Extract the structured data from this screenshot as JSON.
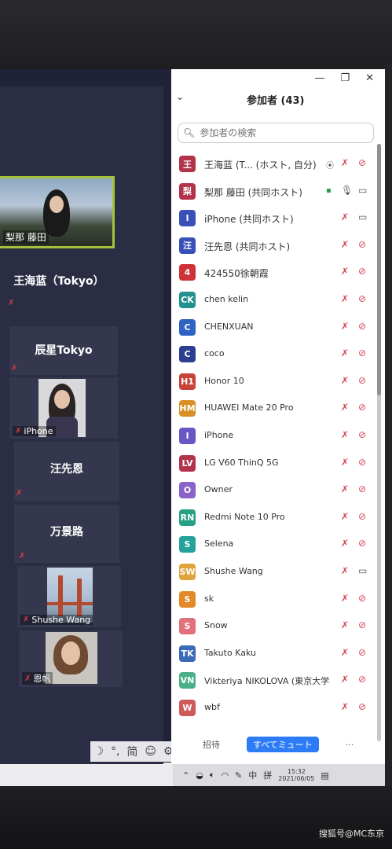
{
  "window": {
    "restore_icon": "restore-icon",
    "close_symbol": "✕"
  },
  "panel": {
    "title": "参加者 (43)",
    "collapse_symbol": "⌄",
    "search_placeholder": "参加者の検索",
    "participants": [
      {
        "initial": "王",
        "name": "王海蓝 (T... (ホスト, 自分)",
        "color": "#b2344b",
        "mic": "muted",
        "video": "off",
        "extra": "⦿"
      },
      {
        "initial": "梨",
        "name": "梨那 藤田 (共同ホスト)",
        "color": "#b2344b",
        "mic": "on",
        "video": "on",
        "extra": "▪"
      },
      {
        "initial": "I",
        "name": "iPhone (共同ホスト)",
        "color": "#3950b8",
        "mic": "muted",
        "video": "on",
        "extra": ""
      },
      {
        "initial": "汪",
        "name": "汪先恩 (共同ホスト)",
        "color": "#3950b8",
        "mic": "muted",
        "video": "off",
        "extra": ""
      },
      {
        "initial": "4",
        "name": "424550徐朝霞",
        "color": "#d0323a",
        "mic": "muted",
        "video": "off",
        "extra": ""
      },
      {
        "initial": "CK",
        "name": "chen kelin",
        "color": "#23928f",
        "mic": "muted",
        "video": "off",
        "extra": ""
      },
      {
        "initial": "C",
        "name": "CHENXUAN",
        "color": "#2e63c4",
        "mic": "muted",
        "video": "off",
        "extra": ""
      },
      {
        "initial": "C",
        "name": "coco",
        "color": "#2c3f8f",
        "mic": "muted",
        "video": "off",
        "extra": ""
      },
      {
        "initial": "H1",
        "name": "Honor 10",
        "color": "#c8443a",
        "mic": "muted",
        "video": "off",
        "extra": ""
      },
      {
        "initial": "HM",
        "name": "HUAWEI Mate 20 Pro",
        "color": "#d79022",
        "mic": "muted",
        "video": "off",
        "extra": ""
      },
      {
        "initial": "I",
        "name": "iPhone",
        "color": "#6a55c4",
        "mic": "muted",
        "video": "off",
        "extra": ""
      },
      {
        "initial": "LV",
        "name": "LG V60 ThinQ 5G",
        "color": "#b2344b",
        "mic": "muted",
        "video": "off",
        "extra": ""
      },
      {
        "initial": "O",
        "name": "Owner",
        "color": "#8a63c8",
        "mic": "muted",
        "video": "off",
        "extra": ""
      },
      {
        "initial": "RN",
        "name": "Redmi Note 10 Pro",
        "color": "#25a085",
        "mic": "muted",
        "video": "off",
        "extra": ""
      },
      {
        "initial": "S",
        "name": "Selena",
        "color": "#25a39a",
        "mic": "muted",
        "video": "off",
        "extra": ""
      },
      {
        "initial": "SW",
        "name": "Shushe Wang",
        "color": "#e0a33a",
        "mic": "muted",
        "video": "on",
        "extra": ""
      },
      {
        "initial": "S",
        "name": "sk",
        "color": "#e28a2a",
        "mic": "muted",
        "video": "off",
        "extra": ""
      },
      {
        "initial": "S",
        "name": "Snow",
        "color": "#e0707a",
        "mic": "muted",
        "video": "off",
        "extra": ""
      },
      {
        "initial": "TK",
        "name": "Takuto Kaku",
        "color": "#3a6ab8",
        "mic": "muted",
        "video": "off",
        "extra": ""
      },
      {
        "initial": "VN",
        "name": "Vikteriya NIKOLOVA (東京大学)",
        "color": "#4ab08a",
        "mic": "muted",
        "video": "off",
        "extra": ""
      },
      {
        "initial": "W",
        "name": "wbf",
        "color": "#d05a5a",
        "mic": "muted",
        "video": "off",
        "extra": ""
      }
    ],
    "invite_label": "招待",
    "mute_all_label": "すべてミュート",
    "more_label": "···"
  },
  "gallery": {
    "tiles": [
      {
        "name": "梨那 藤田",
        "type": "video-active"
      },
      {
        "name": "王海蓝（Tokyo）",
        "type": "name"
      },
      {
        "name": "辰星Tokyo",
        "type": "name"
      },
      {
        "name": "iPhone",
        "type": "video-person"
      },
      {
        "name": "汪先恩",
        "type": "name"
      },
      {
        "name": "万景路",
        "type": "name"
      },
      {
        "name": "Shushe Wang",
        "type": "video-bridge"
      },
      {
        "name": "恩帆",
        "type": "video-woman"
      }
    ]
  },
  "ime": {
    "moon": "☽",
    "punct": "°,",
    "mode": "简",
    "emoji": "☺",
    "settings": "⚙"
  },
  "taskbar": {
    "lang": "中",
    "ime_glyph": "拼",
    "time": "15:32",
    "date": "2021/06/05"
  },
  "watermark": "搜狐号@MC东京"
}
